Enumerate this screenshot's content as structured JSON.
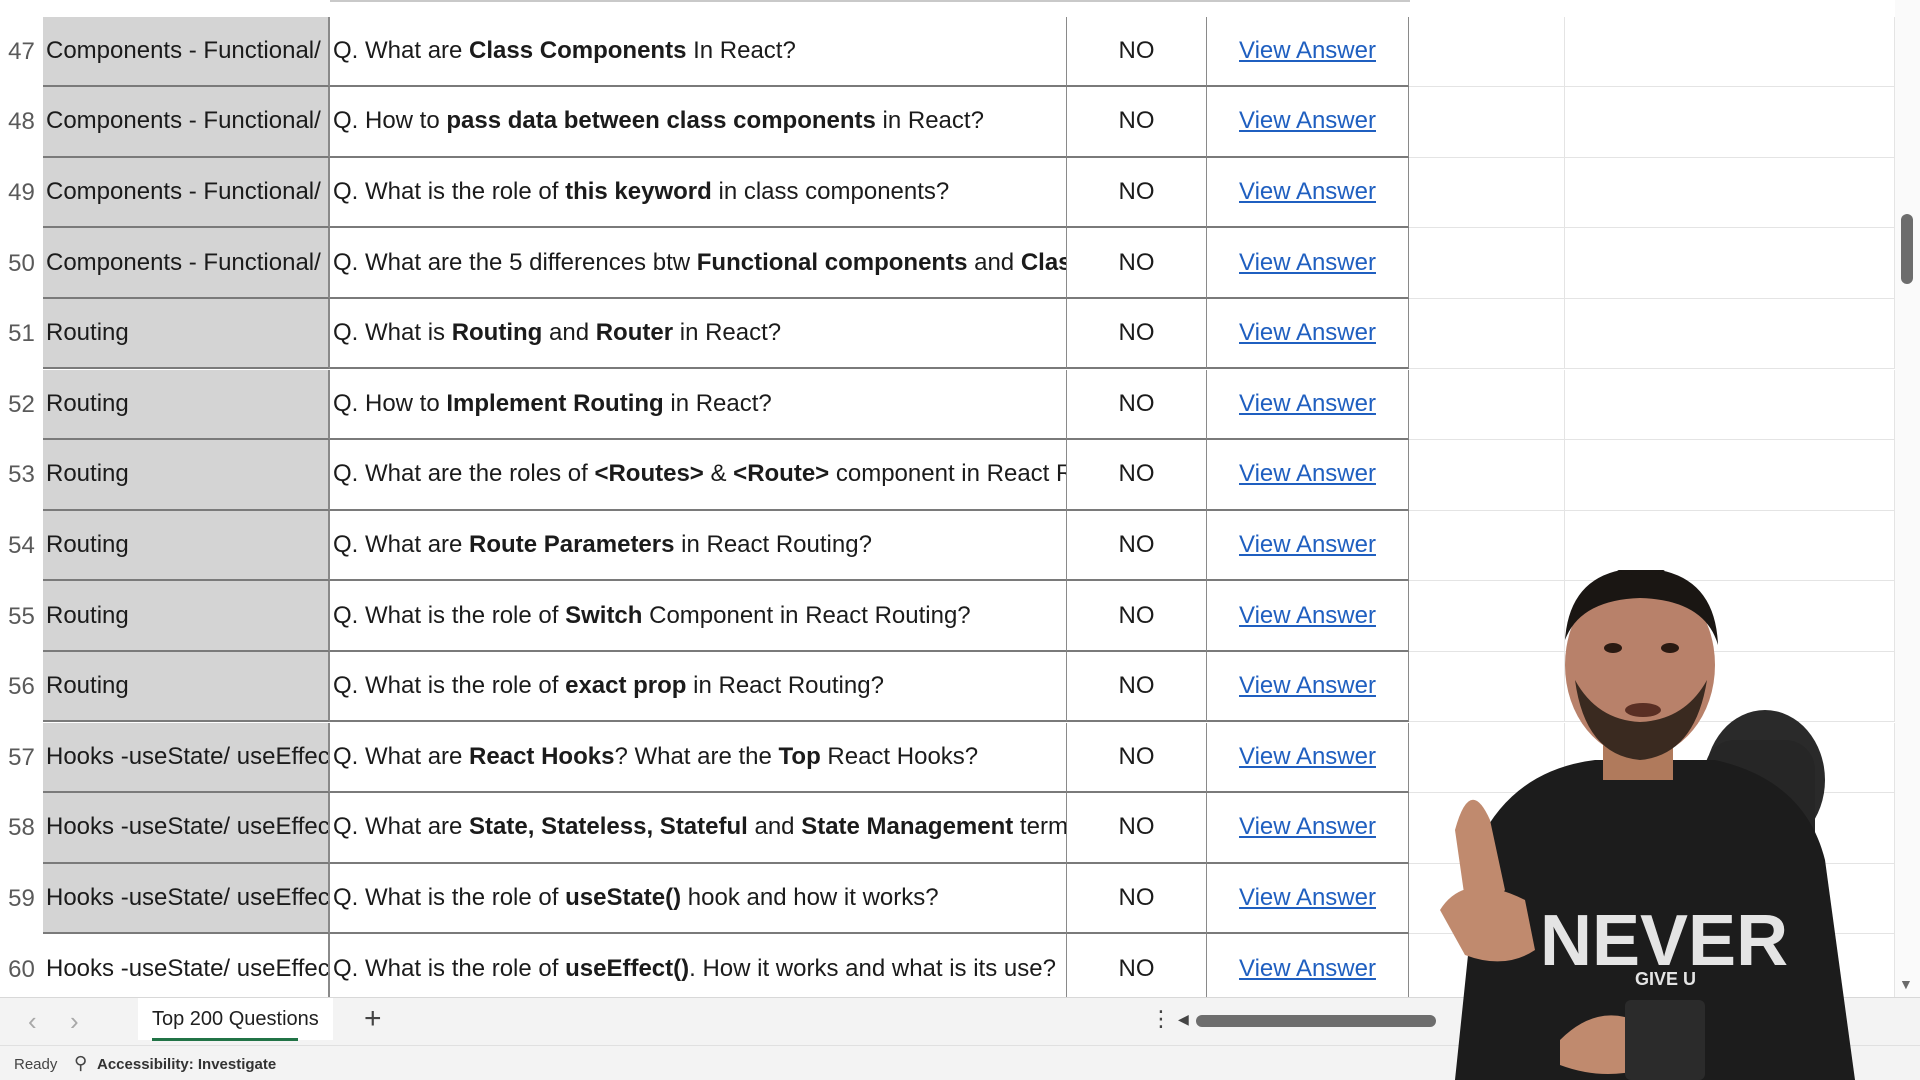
{
  "rows": [
    {
      "num": "47",
      "topic": "Components - Functional/ Cl",
      "topic_white": false,
      "question": [
        {
          "t": "Q. What are "
        },
        {
          "t": "Class Components",
          "b": true
        },
        {
          "t": " In React?"
        }
      ],
      "status": "NO",
      "link": "View Answer"
    },
    {
      "num": "48",
      "topic": "Components - Functional/ Cl",
      "topic_white": false,
      "question": [
        {
          "t": "Q. How to "
        },
        {
          "t": "pass data between class components",
          "b": true
        },
        {
          "t": " in React?"
        }
      ],
      "status": "NO",
      "link": "View Answer"
    },
    {
      "num": "49",
      "topic": "Components - Functional/ Cl",
      "topic_white": false,
      "question": [
        {
          "t": "Q. What is the role of "
        },
        {
          "t": "this keyword",
          "b": true
        },
        {
          "t": " in class components?"
        }
      ],
      "status": "NO",
      "link": "View Answer"
    },
    {
      "num": "50",
      "topic": "Components - Functional/ Cl",
      "topic_white": false,
      "question": [
        {
          "t": "Q. What are the 5 differences btw "
        },
        {
          "t": "Functional components",
          "b": true
        },
        {
          "t": " and "
        },
        {
          "t": "Class comp",
          "b": true
        }
      ],
      "status": "NO",
      "link": "View Answer"
    },
    {
      "num": "51",
      "topic": "Routing",
      "topic_white": false,
      "question": [
        {
          "t": "Q. What is "
        },
        {
          "t": "Routing",
          "b": true
        },
        {
          "t": " and "
        },
        {
          "t": "Router",
          "b": true
        },
        {
          "t": " in React?"
        }
      ],
      "status": "NO",
      "link": "View Answer"
    },
    {
      "num": "52",
      "topic": "Routing",
      "topic_white": false,
      "question": [
        {
          "t": "Q. How to "
        },
        {
          "t": "Implement Routing",
          "b": true
        },
        {
          "t": " in React?"
        }
      ],
      "status": "NO",
      "link": "View Answer"
    },
    {
      "num": "53",
      "topic": "Routing",
      "topic_white": false,
      "question": [
        {
          "t": "Q. What are the roles of "
        },
        {
          "t": "<Routes>",
          "b": true
        },
        {
          "t": " & "
        },
        {
          "t": "<Route>",
          "b": true
        },
        {
          "t": " component in React Routing?"
        }
      ],
      "status": "NO",
      "link": "View Answer"
    },
    {
      "num": "54",
      "topic": "Routing",
      "topic_white": false,
      "question": [
        {
          "t": "Q. What are "
        },
        {
          "t": "Route Parameters",
          "b": true
        },
        {
          "t": " in React Routing?"
        }
      ],
      "status": "NO",
      "link": "View Answer"
    },
    {
      "num": "55",
      "topic": "Routing",
      "topic_white": false,
      "question": [
        {
          "t": "Q. What is the role of "
        },
        {
          "t": "Switch",
          "b": true
        },
        {
          "t": " Component in React Routing?"
        }
      ],
      "status": "NO",
      "link": "View Answer"
    },
    {
      "num": "56",
      "topic": "Routing",
      "topic_white": false,
      "question": [
        {
          "t": "Q. What is the role of "
        },
        {
          "t": "exact prop",
          "b": true
        },
        {
          "t": " in React Routing?"
        }
      ],
      "status": "NO",
      "link": "View Answer"
    },
    {
      "num": "57",
      "topic": "Hooks -useState/ useEffect",
      "topic_white": false,
      "question": [
        {
          "t": "Q. What are "
        },
        {
          "t": "React Hooks",
          "b": true
        },
        {
          "t": "? What are the "
        },
        {
          "t": "Top",
          "b": true
        },
        {
          "t": " React Hooks?"
        }
      ],
      "status": "NO",
      "link": "View Answer"
    },
    {
      "num": "58",
      "topic": "Hooks -useState/ useEffect",
      "topic_white": false,
      "question": [
        {
          "t": "Q. What are "
        },
        {
          "t": "State, Stateless, Stateful",
          "b": true
        },
        {
          "t": " and "
        },
        {
          "t": "State Management",
          "b": true
        },
        {
          "t": " terms?"
        }
      ],
      "status": "NO",
      "link": "View Answer"
    },
    {
      "num": "59",
      "topic": "Hooks -useState/ useEffect",
      "topic_white": false,
      "question": [
        {
          "t": "Q. What is the role of "
        },
        {
          "t": "useState()",
          "b": true
        },
        {
          "t": " hook and how it works?"
        }
      ],
      "status": "NO",
      "link": "View Answer"
    },
    {
      "num": "60",
      "topic": "Hooks -useState/ useEffect",
      "topic_white": true,
      "question": [
        {
          "t": "Q. What is the role of "
        },
        {
          "t": "useEffect()",
          "b": true
        },
        {
          "t": ". How it works and what is its use?"
        }
      ],
      "status": "NO",
      "link": "View Answer"
    }
  ],
  "tabs": {
    "sheet_name": "Top 200 Questions",
    "add_symbol": "+",
    "more_symbol": "⋮"
  },
  "status_bar": {
    "ready": "Ready",
    "accessibility": "Accessibility: Investigate"
  },
  "presenter_shirt_text": "NEVER",
  "presenter_shirt_subtext": "GIVE U",
  "colors": {
    "link": "#1f5fc0",
    "topic_fill": "#d4d4d4",
    "sheet_tab_accent": "#217346"
  }
}
